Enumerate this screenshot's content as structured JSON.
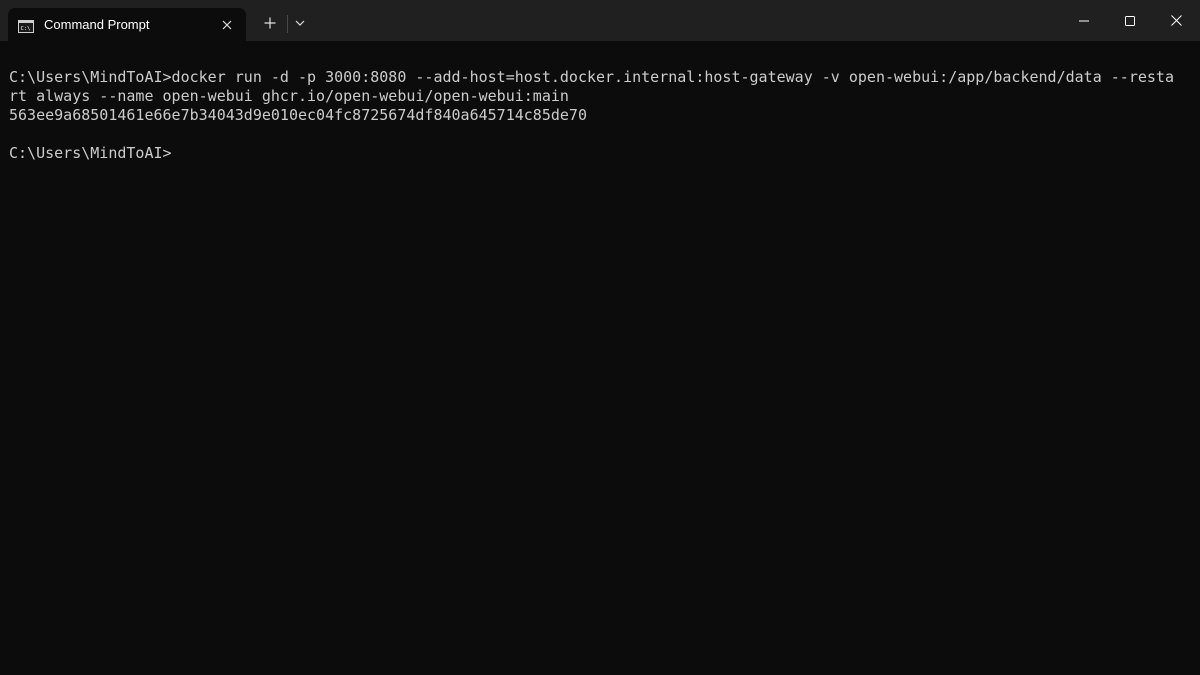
{
  "window": {
    "tab_title": "Command Prompt",
    "tab_icon": "terminal-icon",
    "new_tab_icon": "plus-icon",
    "dropdown_icon": "chevron-down-icon",
    "controls": [
      "minimize-icon",
      "maximize-icon",
      "close-icon"
    ]
  },
  "console": {
    "lines": [
      "C:\\Users\\MindToAI>docker run -d -p 3000:8080 --add-host=host.docker.internal:host-gateway -v open-webui:/app/backend/data --resta",
      "rt always --name open-webui ghcr.io/open-webui/open-webui:main",
      "563ee9a68501461e66e7b34043d9e010ec04fc8725674df840a645714c85de70",
      "",
      "C:\\Users\\MindToAI>"
    ]
  },
  "colors": {
    "titlebar": "#202020",
    "background": "#0c0c0c",
    "text": "#cccccc"
  }
}
